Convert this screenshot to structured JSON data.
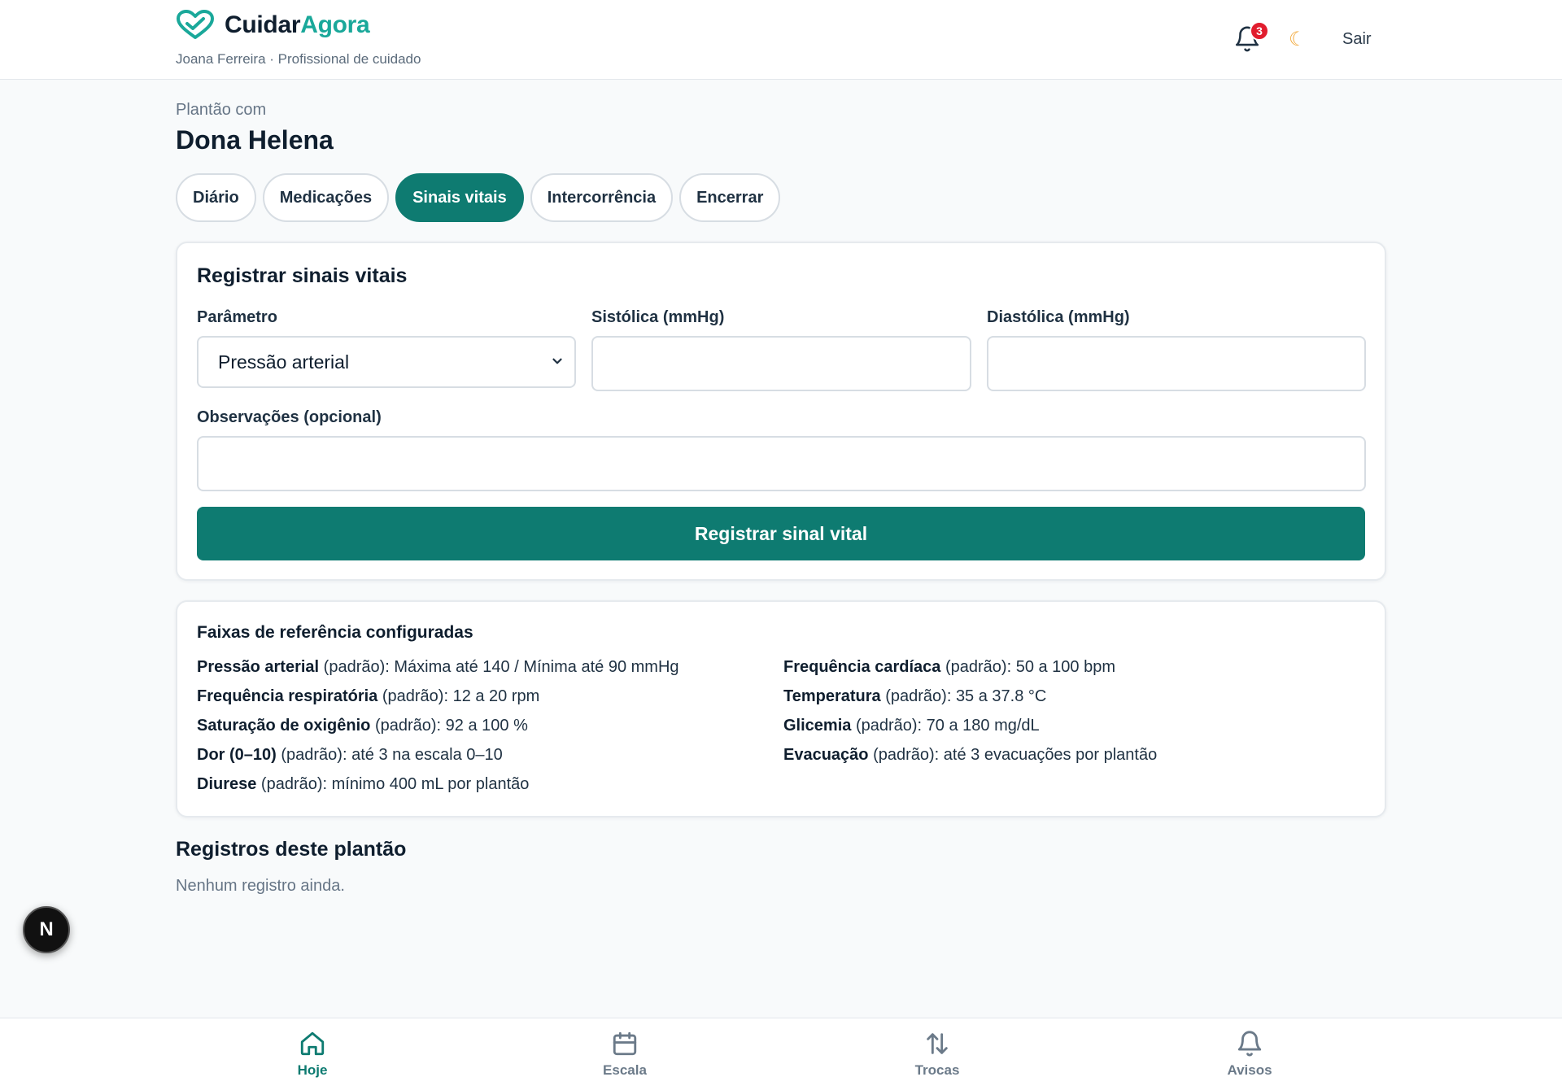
{
  "app": {
    "brand_part1": "Cuidar",
    "brand_part2": "Agora",
    "user_line": "Joana Ferreira · Profissional de cuidado",
    "notifications_count": "3",
    "logout_label": "Sair",
    "accent_color": "#0e7b71",
    "brand_accent_color": "#1aa89a"
  },
  "page": {
    "eyebrow": "Plantão com",
    "title": "Dona Helena"
  },
  "tabs": [
    {
      "label": "Diário",
      "active": false
    },
    {
      "label": "Medicações",
      "active": false
    },
    {
      "label": "Sinais vitais",
      "active": true
    },
    {
      "label": "Intercorrência",
      "active": false
    },
    {
      "label": "Encerrar",
      "active": false
    }
  ],
  "form": {
    "title": "Registrar sinais vitais",
    "parameter_label": "Parâmetro",
    "parameter_value": "Pressão arterial",
    "systolic_label": "Sistólica (mmHg)",
    "systolic_value": "",
    "diastolic_label": "Diastólica (mmHg)",
    "diastolic_value": "",
    "notes_label": "Observações (opcional)",
    "notes_value": "",
    "submit_label": "Registrar sinal vital"
  },
  "reference": {
    "title": "Faixas de referência configuradas",
    "left": [
      {
        "name": "Pressão arterial",
        "desc": " (padrão): Máxima até 140 / Mínima até 90 mmHg"
      },
      {
        "name": "Frequência respiratória",
        "desc": " (padrão): 12 a 20 rpm"
      },
      {
        "name": "Saturação de oxigênio",
        "desc": " (padrão): 92 a 100 %"
      },
      {
        "name": "Dor (0–10)",
        "desc": " (padrão): até 3 na escala 0–10"
      },
      {
        "name": "Diurese",
        "desc": " (padrão): mínimo 400 mL por plantão"
      }
    ],
    "right": [
      {
        "name": "Frequência cardíaca",
        "desc": " (padrão): 50 a 100 bpm"
      },
      {
        "name": "Temperatura",
        "desc": " (padrão): 35 a 37.8 °C"
      },
      {
        "name": "Glicemia",
        "desc": " (padrão): 70 a 180 mg/dL"
      },
      {
        "name": "Evacuação",
        "desc": " (padrão): até 3 evacuações por plantão"
      }
    ]
  },
  "records": {
    "title": "Registros deste plantão",
    "empty_text": "Nenhum registro ainda."
  },
  "fab": {
    "label": "N"
  },
  "bottom_nav": [
    {
      "label": "Hoje",
      "icon": "home-icon",
      "active": true
    },
    {
      "label": "Escala",
      "icon": "calendar-icon",
      "active": false
    },
    {
      "label": "Trocas",
      "icon": "swap-arrows-icon",
      "active": false
    },
    {
      "label": "Avisos",
      "icon": "bell-icon",
      "active": false
    }
  ]
}
